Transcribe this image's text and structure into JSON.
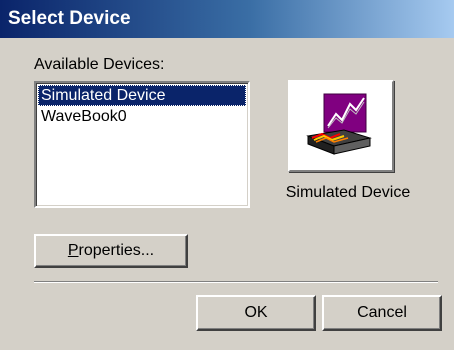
{
  "window": {
    "title": "Select Device"
  },
  "devices": {
    "label": "Available Devices:",
    "items": [
      "Simulated Device",
      "WaveBook0"
    ],
    "selected_index": 0
  },
  "preview": {
    "icon": "device-chart-icon",
    "caption": "Simulated Device"
  },
  "buttons": {
    "properties_mnemonic": "P",
    "properties_rest": "roperties...",
    "ok": "OK",
    "cancel": "Cancel"
  },
  "colors": {
    "title_bar": "#0a246a",
    "selection": "#0a246a",
    "face": "#d4d0c8"
  }
}
